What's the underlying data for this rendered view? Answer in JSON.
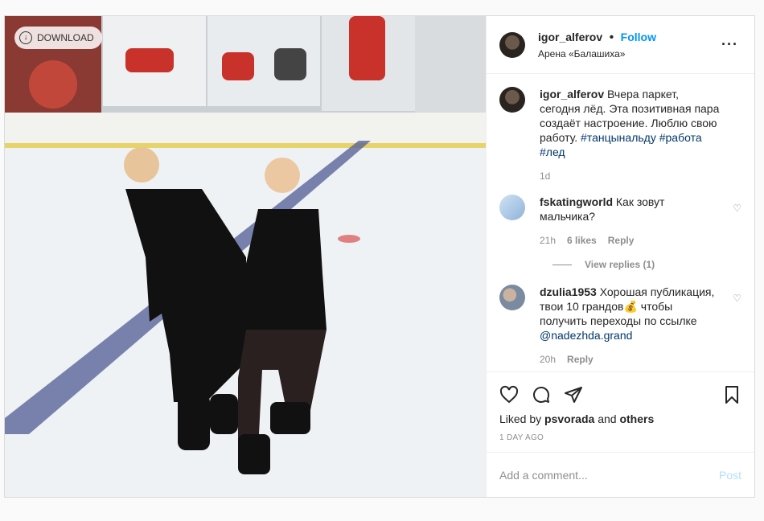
{
  "media": {
    "download_label": "DOWNLOAD"
  },
  "header": {
    "username": "igor_alferov",
    "separator": "•",
    "follow_label": "Follow",
    "location": "Арена «Балашиха»",
    "more_icon": "more-horizontal-icon"
  },
  "caption": {
    "username": "igor_alferov",
    "text": "Вчера паркет, сегодня лёд. Эта позитивная пара создаёт настроение. Люблю свою работу.",
    "hashtags": "#танцынальду #работа #лед",
    "age": "1d"
  },
  "comments": [
    {
      "username": "fskatingworld",
      "text": "Как зовут мальчика?",
      "age": "21h",
      "likes": "6 likes",
      "reply": "Reply",
      "view_replies": "View replies (1)"
    },
    {
      "username": "dzulia1953",
      "text": "Хорошая публикация, твои 10 грандов💰 чтобы получить переходы по ссылке",
      "mention": "@nadezhda.grand",
      "age": "20h",
      "reply": "Reply"
    }
  ],
  "actions": {
    "liked_by_prefix": "Liked by",
    "liked_by_user": "psvorada",
    "and": "and",
    "others": "others",
    "timestamp": "1 DAY AGO"
  },
  "composer": {
    "placeholder": "Add a comment...",
    "post_label": "Post"
  },
  "colors": {
    "link_blue": "#0095f6",
    "post_disabled": "#b2dffc",
    "muted": "#8e8e8e"
  }
}
